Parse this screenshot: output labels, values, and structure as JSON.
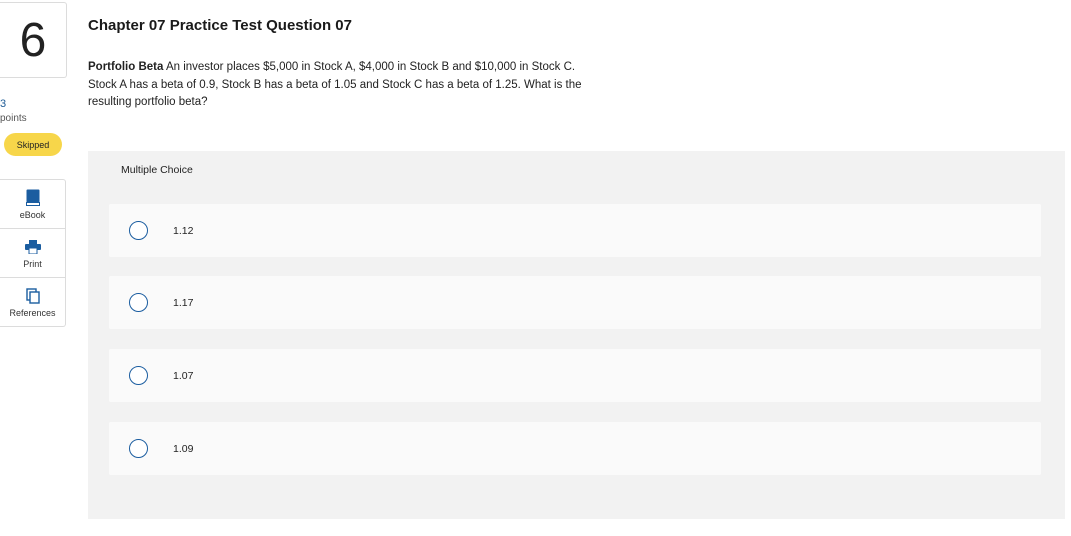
{
  "question": {
    "number": "6",
    "points_value": "3",
    "points_label": "points",
    "status": "Skipped",
    "title": "Chapter 07 Practice Test Question 07",
    "prompt_bold": "Portfolio Beta",
    "prompt_text": " An investor places $5,000 in Stock A, $4,000 in Stock B and $10,000 in Stock C. Stock A has a beta of 0.9, Stock B has a beta of 1.05 and Stock C has a beta of 1.25. What is the resulting portfolio beta?"
  },
  "tools": [
    {
      "label": "eBook",
      "icon": "book-icon"
    },
    {
      "label": "Print",
      "icon": "printer-icon"
    },
    {
      "label": "References",
      "icon": "copy-icon"
    }
  ],
  "multiple_choice": {
    "header": "Multiple Choice",
    "options": [
      {
        "label": "1.12"
      },
      {
        "label": "1.17"
      },
      {
        "label": "1.07"
      },
      {
        "label": "1.09"
      }
    ]
  },
  "colors": {
    "accent": "#1b5da0",
    "badge": "#f7d64a",
    "panel_bg": "#f2f2f2"
  }
}
